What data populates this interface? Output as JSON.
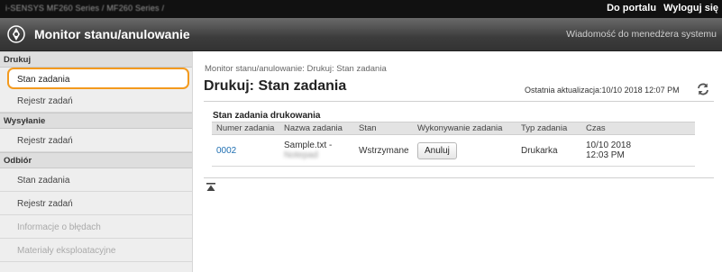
{
  "topbar": {
    "device": "i-SENSYS MF260 Series / MF260 Series /",
    "portal_link": "Do portalu",
    "logout_link": "Wyloguj się"
  },
  "titlebar": {
    "title": "Monitor stanu/anulowanie",
    "message_link": "Wiadomość do menedżera systemu"
  },
  "sidebar": {
    "sections": [
      {
        "heading": "Drukuj",
        "items": [
          {
            "label": "Stan zadania",
            "selected": true
          },
          {
            "label": "Rejestr zadań"
          }
        ]
      },
      {
        "heading": "Wysyłanie",
        "items": [
          {
            "label": "Rejestr zadań"
          }
        ]
      },
      {
        "heading": "Odbiór",
        "items": [
          {
            "label": "Stan zadania"
          },
          {
            "label": "Rejestr zadań"
          },
          {
            "label": "Informacje o błędach"
          },
          {
            "label": "Materiały eksploatacyjne"
          }
        ]
      }
    ]
  },
  "main": {
    "breadcrumb": "Monitor stanu/anulowanie: Drukuj: Stan zadania",
    "title": "Drukuj: Stan zadania",
    "last_updated": "Ostatnia aktualizacja:10/10 2018 12:07 PM",
    "section_title": "Stan zadania drukowania",
    "table": {
      "headers": [
        "Numer zadania",
        "Nazwa zadania",
        "Stan",
        "Wykonywanie zadania",
        "Typ zadania",
        "Czas"
      ],
      "rows": [
        {
          "number": "0002",
          "name_line1": "Sample.txt -",
          "name_line2": "Notepad",
          "status": "Wstrzymane",
          "action": "Anuluj",
          "type": "Drukarka",
          "time_line1": "10/10 2018",
          "time_line2": "12:03 PM"
        }
      ]
    }
  },
  "colors": {
    "selected_border": "#f39a1e",
    "link": "#1f6fb2",
    "topbar_bg": "#111111"
  }
}
